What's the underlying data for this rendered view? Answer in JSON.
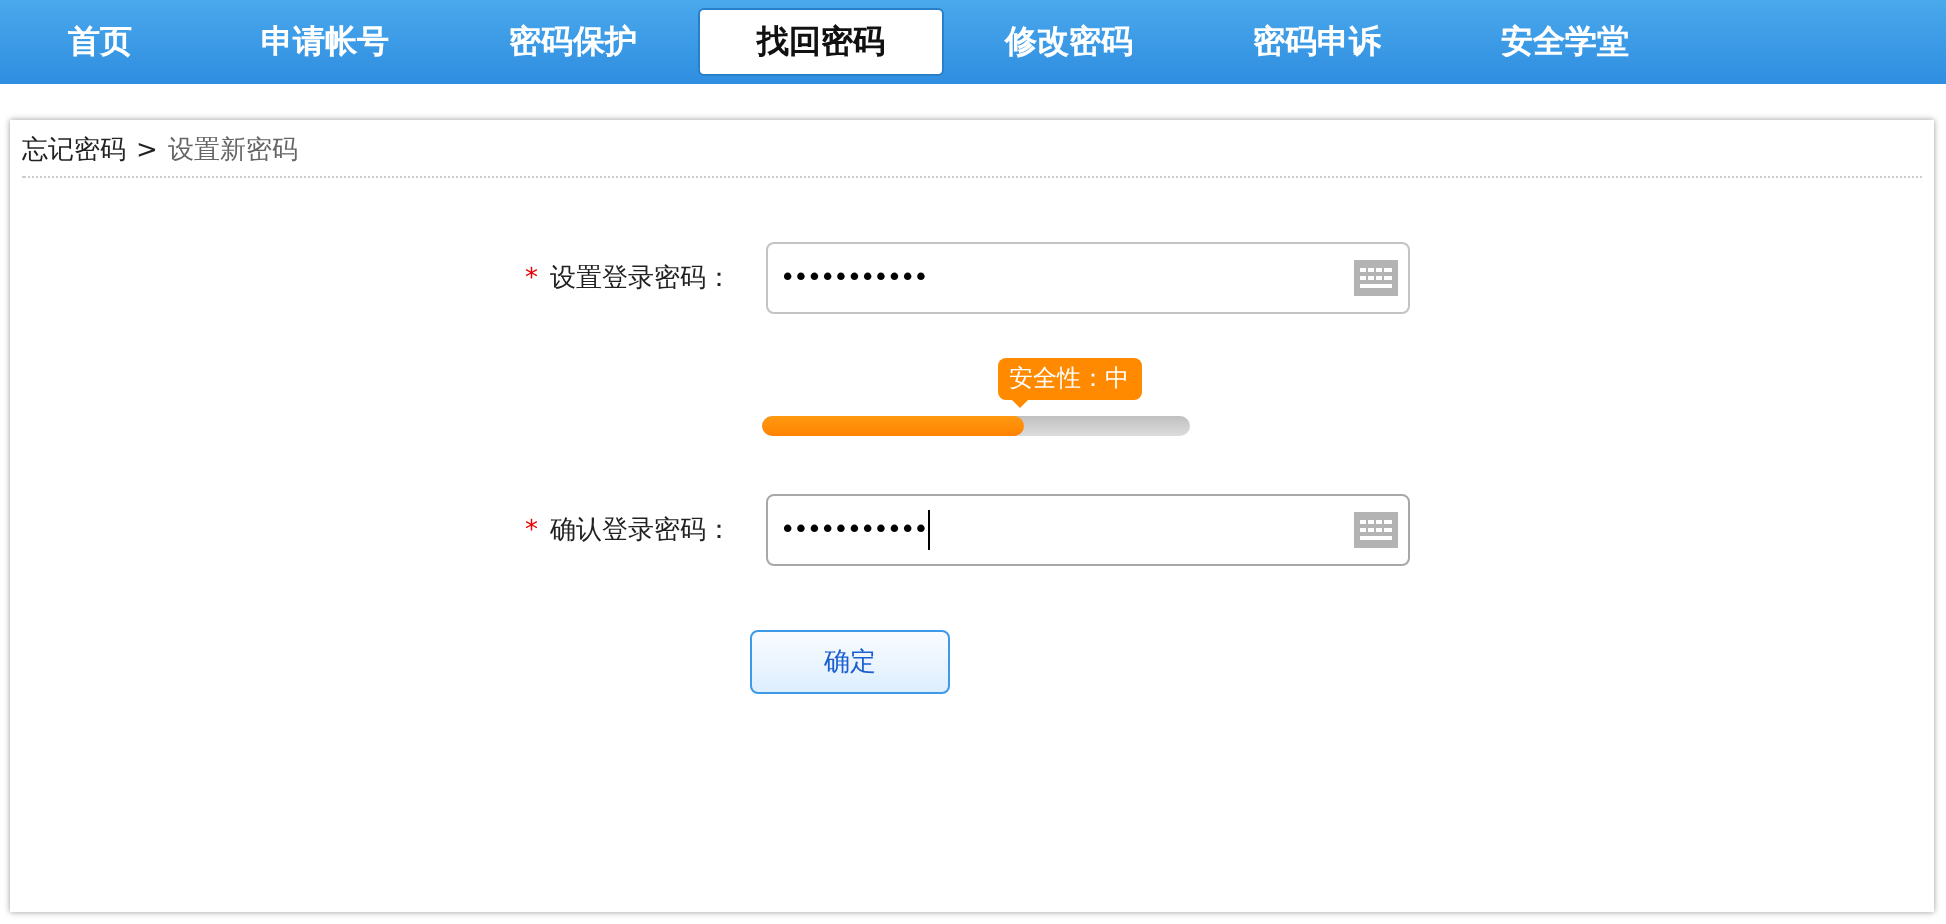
{
  "nav": {
    "tabs": [
      {
        "label": "首页",
        "selected": false
      },
      {
        "label": "申请帐号",
        "selected": false
      },
      {
        "label": "密码保护",
        "selected": false
      },
      {
        "label": "找回密码",
        "selected": true
      },
      {
        "label": "修改密码",
        "selected": false
      },
      {
        "label": "密码申诉",
        "selected": false
      },
      {
        "label": "安全学堂",
        "selected": false
      }
    ]
  },
  "breadcrumb": {
    "parent": "忘记密码",
    "separator": ">",
    "current": "设置新密码"
  },
  "form": {
    "fields": [
      {
        "required_mark": "*",
        "label": "设置登录密码：",
        "value": "•••••••••••",
        "focused": false
      },
      {
        "required_mark": "*",
        "label": "确认登录密码：",
        "value": "•••••••••••",
        "focused": true
      }
    ],
    "strength": {
      "label": "安全性：中",
      "level": 0.61
    },
    "submit": "确定"
  }
}
